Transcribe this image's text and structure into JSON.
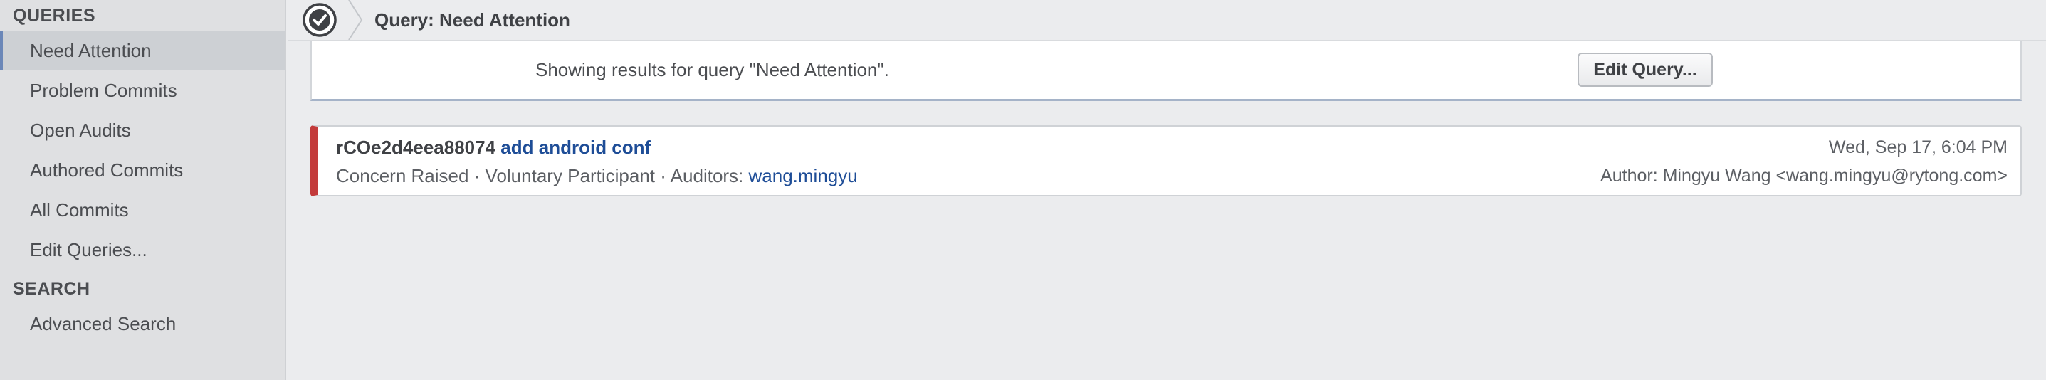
{
  "sidebar": {
    "queries_heading": "QUERIES",
    "items": [
      {
        "label": "Need Attention",
        "selected": true
      },
      {
        "label": "Problem Commits"
      },
      {
        "label": "Open Audits"
      },
      {
        "label": "Authored Commits"
      },
      {
        "label": "All Commits"
      },
      {
        "label": "Edit Queries..."
      }
    ],
    "search_heading": "SEARCH",
    "search_items": [
      {
        "label": "Advanced Search"
      }
    ]
  },
  "header": {
    "icon": "check-circle-icon",
    "title": "Query: Need Attention"
  },
  "info": {
    "text": "Showing results for query \"Need Attention\".",
    "edit_button": "Edit Query..."
  },
  "commit": {
    "id": "rCOe2d4eea88074",
    "message": "add android conf",
    "date": "Wed, Sep 17, 6:04 PM",
    "status": "Concern Raised · Voluntary Participant · Auditors: ",
    "auditor": "wang.mingyu",
    "author": "Author: Mingyu Wang <wang.mingyu@rytong.com>",
    "status_color": "#c33b3b"
  },
  "colors": {
    "link": "#1e4d97",
    "accent": "#6b87b8"
  }
}
